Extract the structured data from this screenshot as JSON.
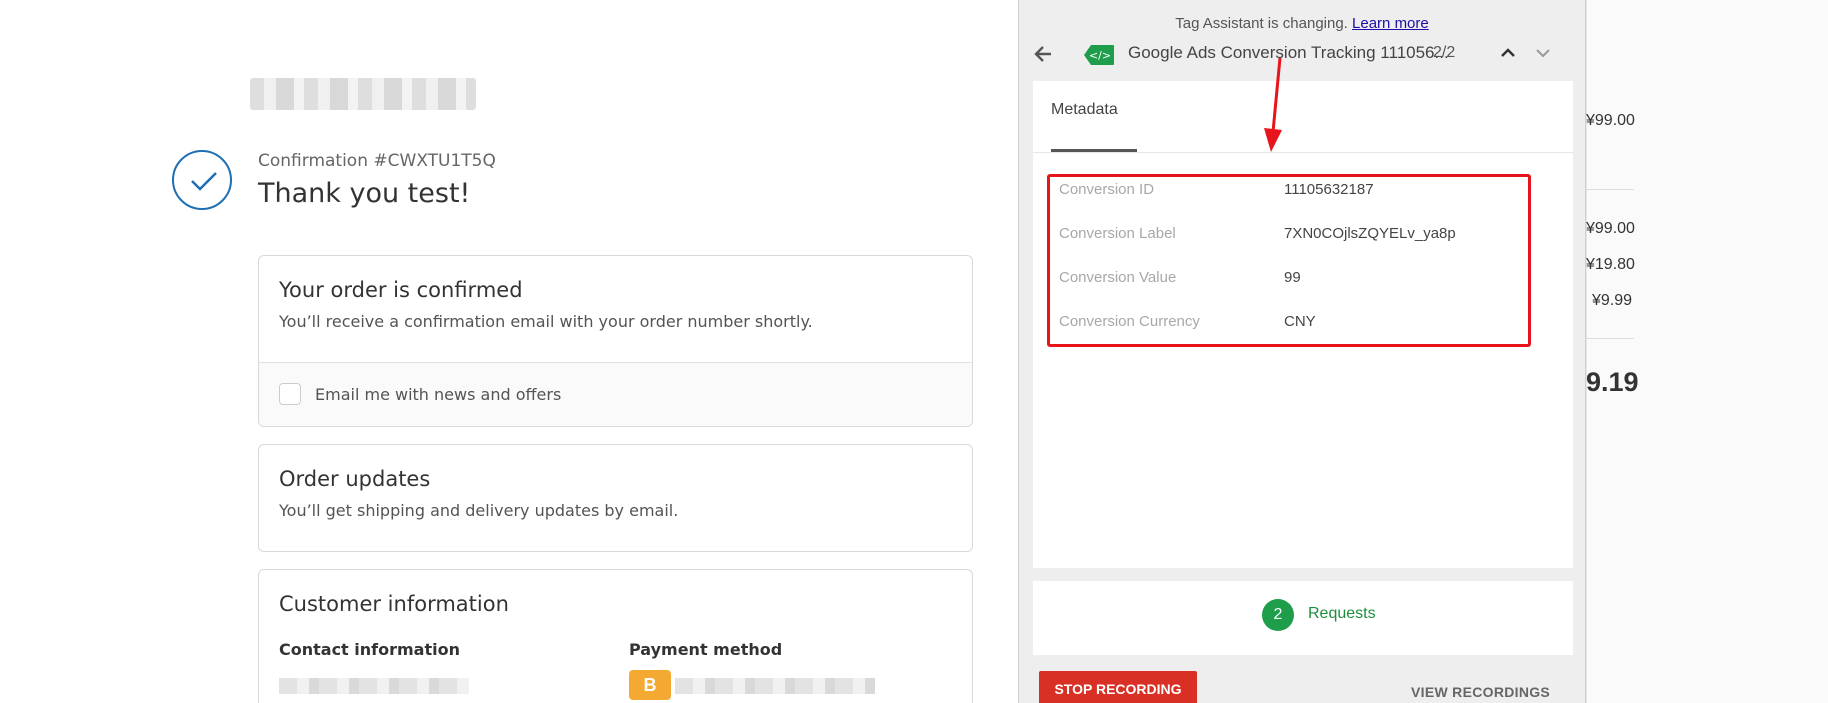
{
  "order": {
    "confirmation_number": "Confirmation #CWXTU1T5Q",
    "thank_you": "Thank you test!",
    "confirmed_title": "Your order is confirmed",
    "confirmed_text": "You’ll receive a confirmation email with your order number shortly.",
    "email_opt_in_label": "Email me with news and offers",
    "updates_title": "Order updates",
    "updates_text": "You’ll get shipping and delivery updates by email.",
    "customer_title": "Customer information",
    "contact_label": "Contact information",
    "payment_label": "Payment method",
    "payment_badge": "B"
  },
  "summary": {
    "subtotal_item": "¥99.00",
    "subtotal": "¥99.00",
    "shipping": "¥19.80",
    "taxes": "¥9.99",
    "total": "9.19"
  },
  "tag_assistant": {
    "notice_text": "Tag Assistant is changing.",
    "notice_link": "Learn more",
    "tag_title": "Google Ads Conversion Tracking 111056...",
    "pager": "2/2",
    "tab_metadata": "Metadata",
    "metadata": [
      {
        "key": "Conversion ID",
        "value": "11105632187"
      },
      {
        "key": "Conversion Label",
        "value": "7XN0COjlsZQYELv_ya8p"
      },
      {
        "key": "Conversion Value",
        "value": "99"
      },
      {
        "key": "Conversion Currency",
        "value": "CNY"
      }
    ],
    "requests_count": "2",
    "requests_label": "Requests",
    "stop_recording": "STOP RECORDING",
    "view_recordings": "VIEW RECORDINGS"
  },
  "colors": {
    "accent_blue": "#1f6fb2",
    "highlight_red": "#e8141b",
    "stop_red": "#d93025",
    "requests_green": "#1e9e4a",
    "tag_green": "#1e9e4a"
  },
  "icons": [
    "checkmark-icon",
    "back-arrow-icon",
    "tag-icon",
    "chevron-up-icon",
    "chevron-down-icon"
  ]
}
